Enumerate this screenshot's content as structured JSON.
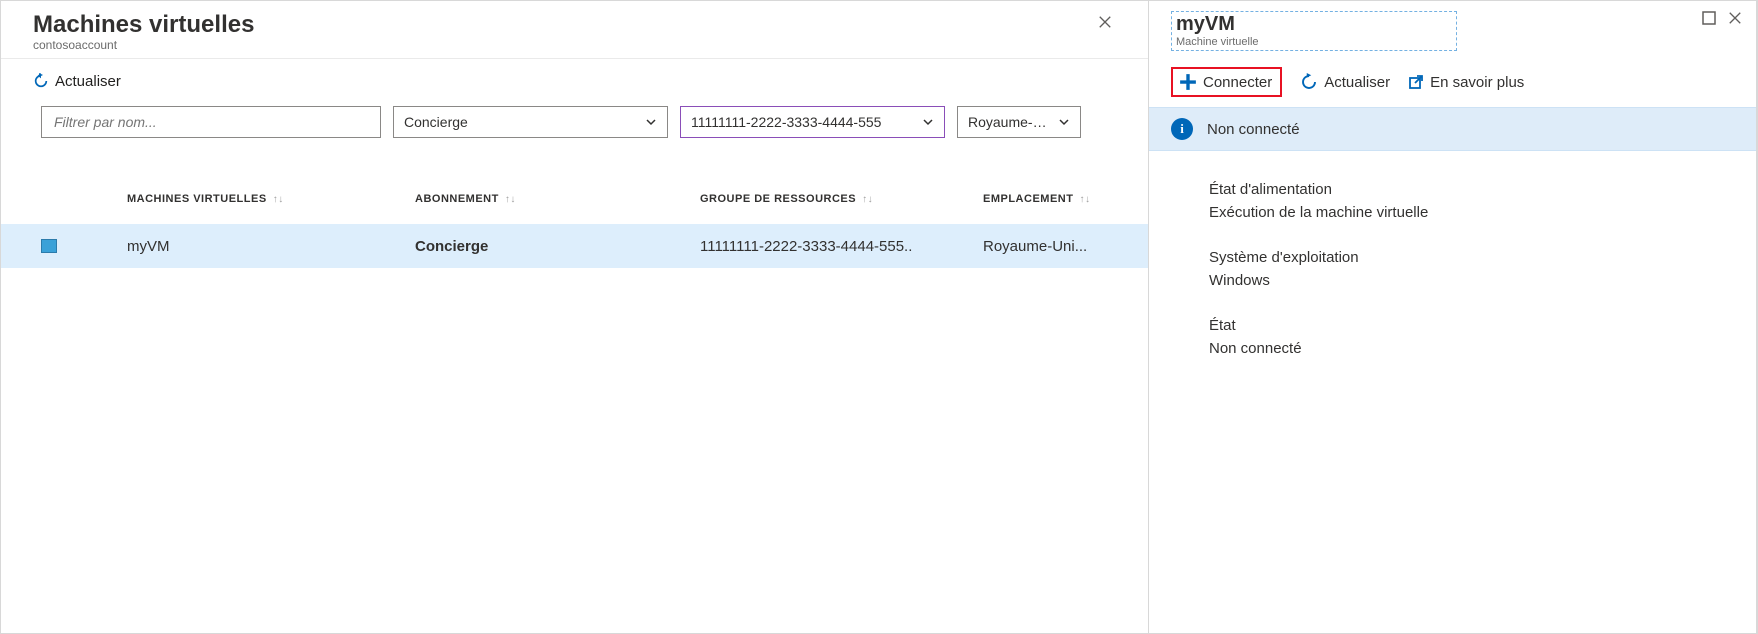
{
  "left": {
    "title": "Machines virtuelles",
    "subtitle": "contosoaccount",
    "refresh_label": "Actualiser",
    "filter_placeholder": "Filtrer par nom...",
    "select_resourcegroup": "Concierge",
    "select_subscription": "11111111-2222-3333-4444-555",
    "select_location": "Royaume-U...",
    "columns": {
      "vm": "MACHINES VIRTUELLES",
      "sub": "ABONNEMENT",
      "rg": "GROUPE DE RESSOURCES",
      "loc": "EMPLACEMENT"
    },
    "rows": [
      {
        "name": "myVM",
        "subscription": "Concierge",
        "resource_group": "11111111-2222-3333-4444-555..",
        "location": "Royaume-Uni..."
      }
    ]
  },
  "right": {
    "title": "myVM",
    "subtitle": "Machine virtuelle",
    "connect_label": "Connecter",
    "refresh_label": "Actualiser",
    "learnmore_label": "En savoir plus",
    "status_text": "Non connecté",
    "props": {
      "power_label": "État d'alimentation",
      "power_value": "Exécution de la machine virtuelle",
      "os_label": "Système d'exploitation",
      "os_value": "Windows",
      "state_label": "État",
      "state_value": "Non connecté"
    }
  }
}
